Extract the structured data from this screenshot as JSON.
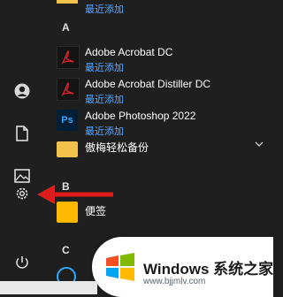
{
  "sections": [
    {
      "letter": "A"
    },
    {
      "letter": "B"
    },
    {
      "letter": "C"
    }
  ],
  "top_partial_sub": "最近添加",
  "apps": [
    {
      "name": "Adobe Acrobat DC",
      "sub": "最近添加",
      "icon": "adobe-acrobat-icon"
    },
    {
      "name": "Adobe Acrobat Distiller DC",
      "sub": "最近添加",
      "icon": "adobe-acrobat-distiller-icon"
    },
    {
      "name": "Adobe Photoshop 2022",
      "sub": "最近添加",
      "icon": "photoshop-icon",
      "icon_text": "Ps"
    },
    {
      "name": "傲梅轻松备份",
      "icon": "folder-icon"
    },
    {
      "name": "便签",
      "icon": "sticky-notes-icon"
    }
  ],
  "rail": [
    {
      "name": "user-account",
      "icon": "user-icon"
    },
    {
      "name": "documents",
      "icon": "document-icon"
    },
    {
      "name": "pictures",
      "icon": "picture-icon"
    },
    {
      "name": "settings",
      "icon": "gear-icon"
    },
    {
      "name": "power",
      "icon": "power-icon"
    }
  ],
  "watermark": {
    "title": "Windows 系统之家",
    "url": "www.bjjmlv.com"
  },
  "colors": {
    "link": "#5ba7ff",
    "background": "#1f1f1f",
    "arrow": "#e01b1b"
  }
}
